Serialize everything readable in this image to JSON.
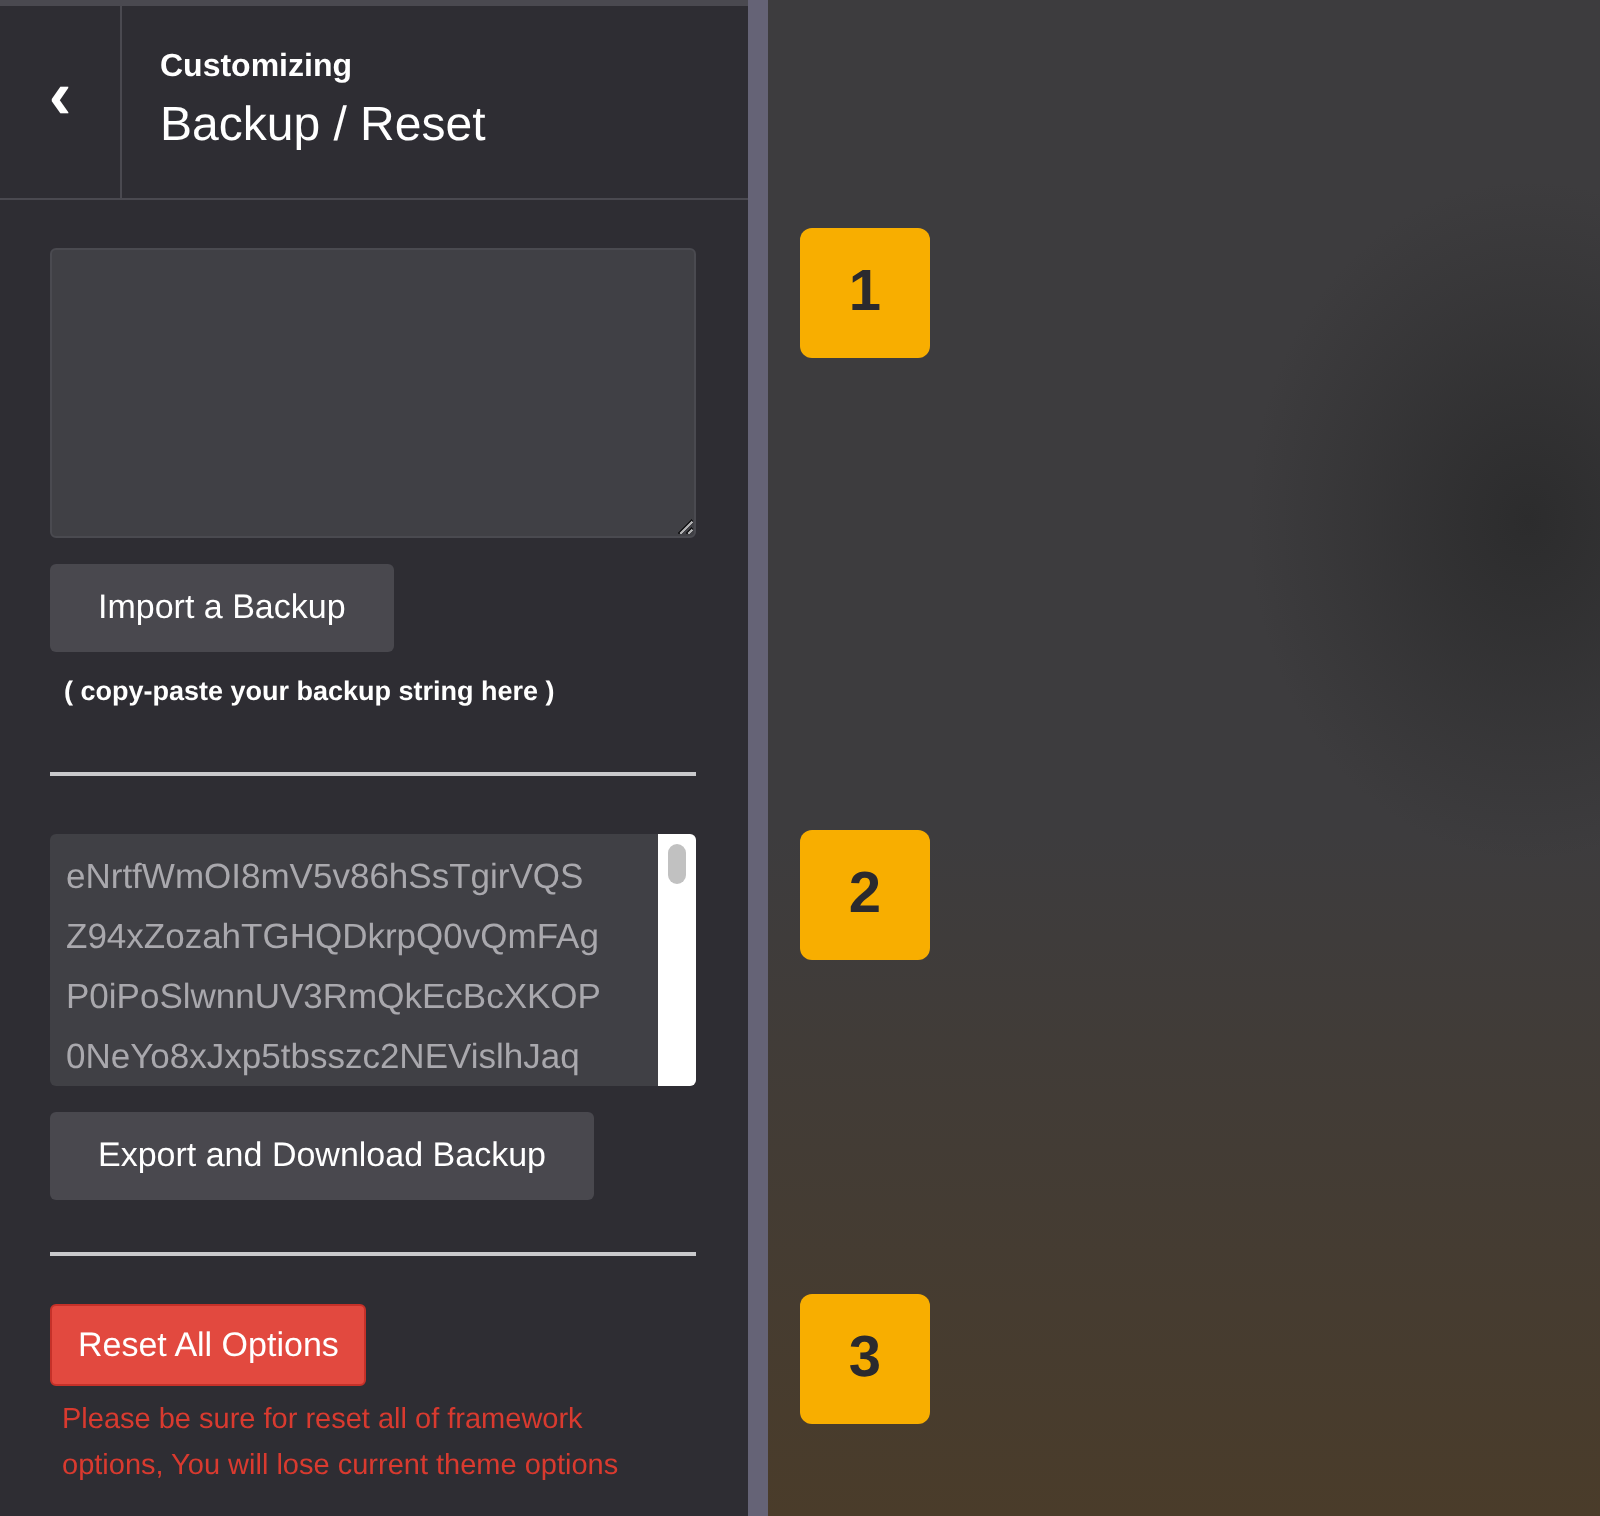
{
  "header": {
    "back": "‹",
    "breadcrumb": "Customizing",
    "title": "Backup / Reset"
  },
  "import": {
    "button": "Import a Backup",
    "note": "( copy-paste your backup string here )"
  },
  "export": {
    "value_lines": [
      "eNrtfWmOI8mV5v86hSsTgirVQS",
      "Z94xZozahTGHQDkrpQ0vQmFAg",
      "P0iPoSlwnnUV3RmQkEcBcXKOP",
      "0NeYo8xJxp5tbsszc2NEVislhJaq"
    ],
    "button": "Export and Download Backup"
  },
  "reset": {
    "button": "Reset All Options",
    "warning": "Please be sure for reset all of framework options, You will lose current theme options"
  },
  "badges": [
    "1",
    "2",
    "3"
  ]
}
